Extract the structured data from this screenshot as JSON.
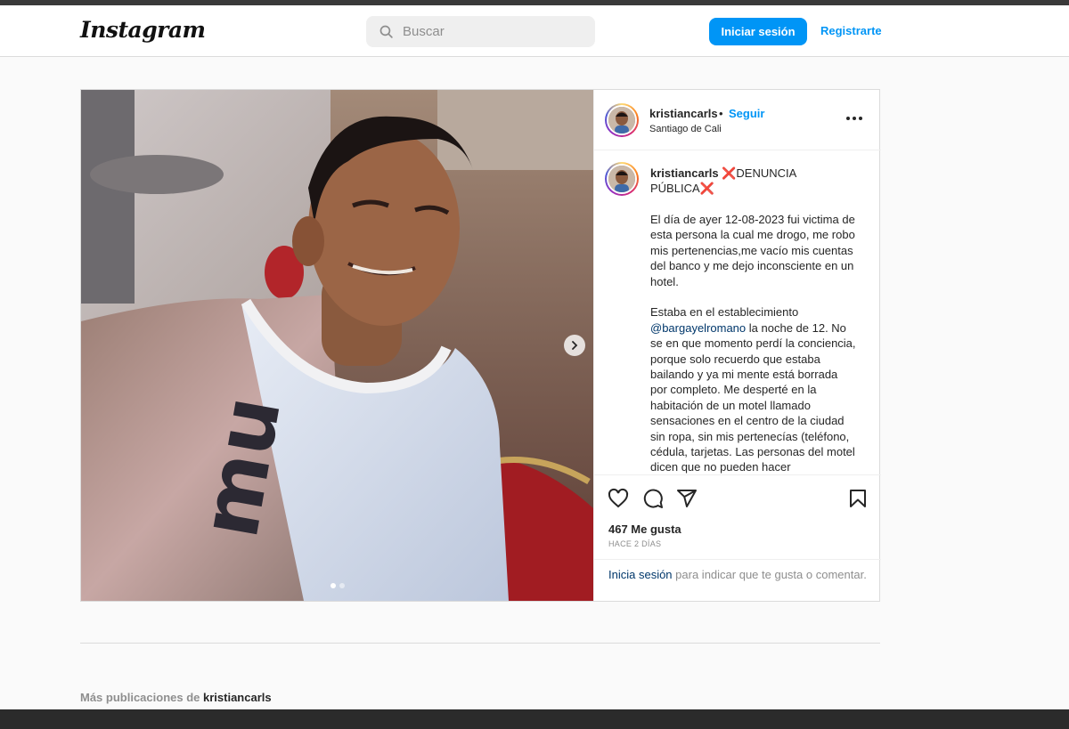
{
  "header": {
    "logo": "Instagram",
    "search_placeholder": "Buscar",
    "login_button": "Iniciar sesión",
    "register_link": "Registrarte"
  },
  "post": {
    "username": "kristiancarls",
    "separator": "•",
    "follow_label": "Seguir",
    "location": "Santiago de Cali",
    "caption_title_user": "kristiancarls",
    "caption_title_mark": "❌",
    "caption_title_text1": "DENUNCIA",
    "caption_title_text2": "PÚBLICA",
    "caption_p1": "El día de ayer 12-08-2023 fui victima de esta persona la cual me drogo, me robo mis pertenencias,me vacío mis cuentas del banco y me dejo inconsciente en un hotel.",
    "caption_p2_pre": "Estaba en el establecimiento",
    "caption_p2_mention": "@bargayelromano",
    "caption_p2_post": "la noche de 12. No se en que momento perdí la conciencia, porque solo recuerdo que estaba bailando y ya mi mente está borrada por completo. Me desperté en la habitación de un motel llamado sensaciones en el centro de la ciudad sin ropa, sin mis pertenecías (teléfono, cédula, tarjetas. Las personas del motel dicen que no pueden hacer",
    "likes": "467 Me gusta",
    "time": "HACE 2 DÍAS",
    "login_prompt_link": "Inicia sesión",
    "login_prompt_text": "para indicar que te gusta o comentar.",
    "carousel_index": 1,
    "carousel_total": 2
  },
  "footer": {
    "more_posts_prefix": "Más publicaciones de",
    "more_posts_user": "kristiancarls"
  },
  "colors": {
    "accent": "#0095f6",
    "link": "#00376b",
    "text": "#262626",
    "muted": "#8e8e8e"
  }
}
